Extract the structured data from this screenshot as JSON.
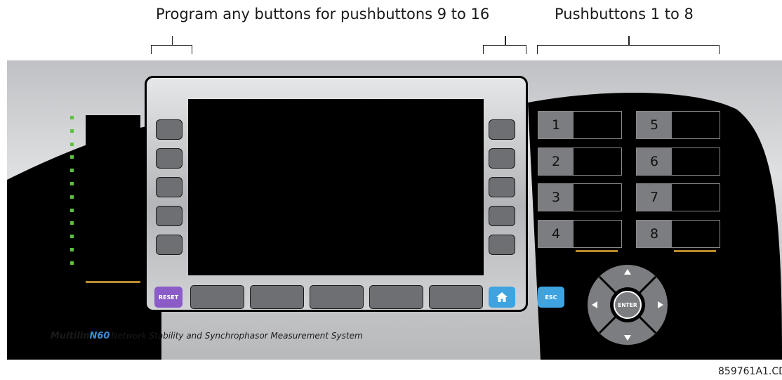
{
  "callouts": {
    "left": "Program any buttons for pushbuttons 9 to 16",
    "right": "Pushbuttons 1 to 8"
  },
  "panel": {
    "brand_name": "Multilin",
    "model": "N60",
    "product_line": "Network Stability and Synchrophasor Measurement System",
    "status_led_count": 12,
    "colors": {
      "led_green": "#5cc23c",
      "reset_purple": "#8b5cc8",
      "nav_blue": "#3fa3e0",
      "accent_gold": "#b98a2a",
      "faceplate_black": "#000000"
    }
  },
  "buttons": {
    "reset": "RESET",
    "home_icon": "home-icon",
    "esc": "ESC",
    "enter": "ENTER"
  },
  "pushbuttons": [
    "1",
    "2",
    "3",
    "4",
    "5",
    "6",
    "7",
    "8"
  ],
  "figure_id": "859761A1.CDR"
}
